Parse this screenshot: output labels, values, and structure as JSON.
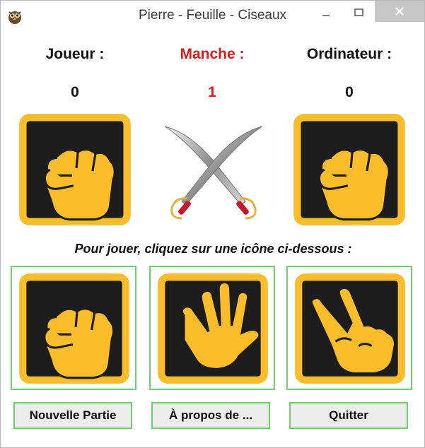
{
  "window": {
    "title": "Pierre - Feuille - Ciseaux"
  },
  "scoreboard": {
    "player_label": "Joueur :",
    "round_label": "Manche :",
    "computer_label": "Ordinateur :",
    "player_score": "0",
    "round": "1",
    "computer_score": "0"
  },
  "colors": {
    "accent_red": "#e01818",
    "tile_yellow": "#fbbd2a",
    "tile_dark": "#1d1d1d",
    "choice_border": "#6ccf6c"
  },
  "current_play": {
    "player_icon": "rock-fist-icon",
    "center_icon": "crossed-swords-icon",
    "computer_icon": "rock-fist-icon"
  },
  "instruction": "Pour jouer, cliquez sur une icône ci-dessous :",
  "choices": [
    {
      "icon": "rock-fist-icon"
    },
    {
      "icon": "paper-hand-icon"
    },
    {
      "icon": "scissors-hand-icon"
    }
  ],
  "buttons": {
    "new_game": "Nouvelle Partie",
    "about": "À propos de ...",
    "quit": "Quitter"
  }
}
